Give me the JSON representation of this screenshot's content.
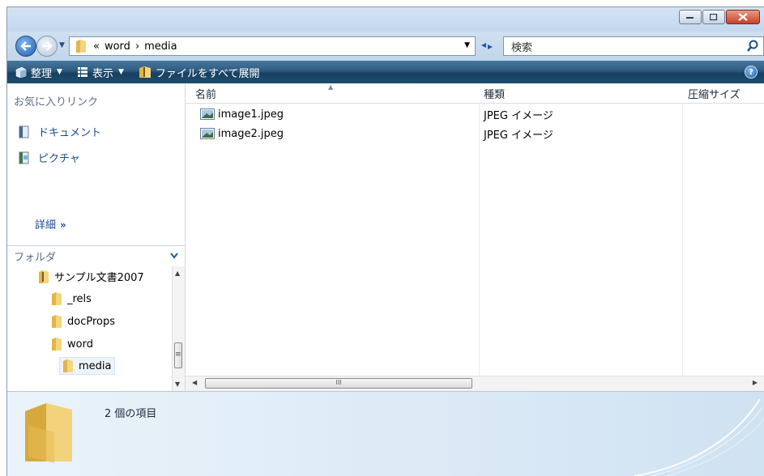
{
  "address": {
    "crumbs": [
      "«",
      "word",
      "›",
      "media"
    ]
  },
  "search": {
    "placeholder": "検索"
  },
  "toolbar": {
    "organize": "整理",
    "views": "表示",
    "extract_all": "ファイルをすべて展開",
    "help": "?"
  },
  "favorites": {
    "heading": "お気に入りリンク",
    "items": [
      {
        "label": "ドキュメント",
        "icon": "documents-icon"
      },
      {
        "label": "ピクチャ",
        "icon": "pictures-icon"
      }
    ],
    "more": "詳細",
    "more_glyph": "»"
  },
  "folders": {
    "heading": "フォルダ",
    "tree": [
      {
        "label": "サンプル文書2007",
        "level": 0,
        "icon": "zip-folder-icon"
      },
      {
        "label": "_rels",
        "level": 1,
        "icon": "folder-icon"
      },
      {
        "label": "docProps",
        "level": 1,
        "icon": "folder-icon"
      },
      {
        "label": "word",
        "level": 1,
        "icon": "folder-icon"
      },
      {
        "label": "media",
        "level": 2,
        "icon": "folder-icon",
        "selected": true
      }
    ]
  },
  "columns": {
    "name": "名前",
    "type": "種類",
    "compressed_size": "圧縮サイズ"
  },
  "files": [
    {
      "name": "image1.jpeg",
      "type": "JPEG イメージ",
      "icon": "image-file-icon"
    },
    {
      "name": "image2.jpeg",
      "type": "JPEG イメージ",
      "icon": "image-file-icon"
    }
  ],
  "details": {
    "count": "2 個の項目"
  },
  "scrollbar": {
    "grip": "III",
    "vgrip": "≡"
  },
  "colors": {
    "toolbar_dark": "#183f5f",
    "link_blue": "#1a4b8b",
    "close_red": "#c8412a"
  }
}
